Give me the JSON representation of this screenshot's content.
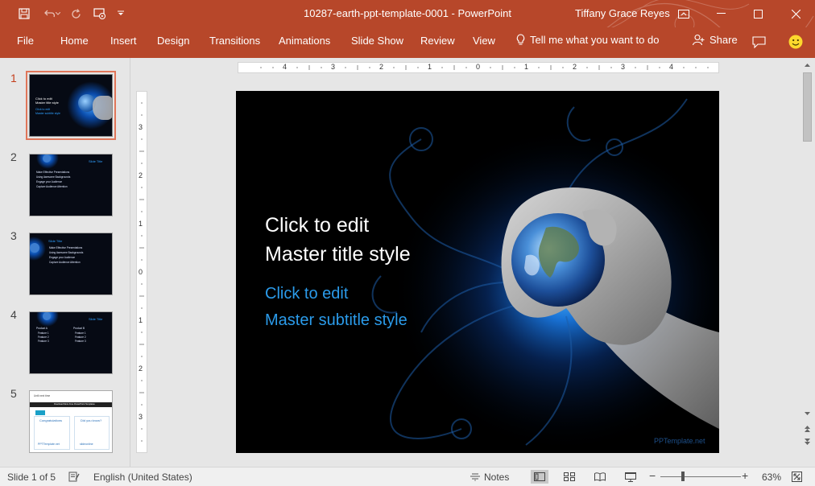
{
  "window": {
    "title": "10287-earth-ppt-template-0001  -  PowerPoint",
    "user": "Tiffany Grace Reyes"
  },
  "ribbon": {
    "tabs": [
      "File",
      "Home",
      "Insert",
      "Design",
      "Transitions",
      "Animations",
      "Slide Show",
      "Review",
      "View"
    ],
    "tell_me": "Tell me what you want to do",
    "share": "Share"
  },
  "thumbnails": {
    "numbers": [
      "1",
      "2",
      "3",
      "4",
      "5"
    ],
    "selected": 1,
    "slide1": {
      "title": "Click to edit\nMaster title style",
      "sub": "Click to edit\nMaster subtitle style"
    },
    "slide2": {
      "heading": "Slide Title",
      "bullets": [
        "Make Effective Presentations",
        "Using Awesome Backgrounds",
        "Engage your Audience",
        "Capture Audience Attention"
      ]
    },
    "slide3": {
      "heading": "Slide Title",
      "bullets": [
        "Make Effective Presentations",
        "Using Awesome Backgrounds",
        "Engage your Audience",
        "Capture Audience Attention"
      ]
    },
    "slide4": {
      "heading": "Slide Title",
      "col1_head": "Product A",
      "col2_head": "Product B",
      "features": [
        "Feature 1",
        "Feature 2",
        "Feature 3"
      ]
    },
    "slide5": {
      "top": "Until next time",
      "banner": "Download More Free PowerPoint Templates",
      "left_head": "Congratulations",
      "right_head": "Did you know?",
      "left_logo": "PPTTemplate.net",
      "right_logo": "slideonline"
    }
  },
  "rulers": {
    "horizontal": [
      "4",
      "3",
      "2",
      "1",
      "0",
      "1",
      "2",
      "3",
      "4"
    ],
    "vertical": [
      "3",
      "2",
      "1",
      "0",
      "1",
      "2",
      "3"
    ]
  },
  "slide": {
    "title_line1": "Click to edit",
    "title_line2": "Master title style",
    "subtitle_line1": "Click to edit",
    "subtitle_line2": "Master subtitle style",
    "logo_text": "PPTemplate.net"
  },
  "statusbar": {
    "slide_info": "Slide 1 of 5",
    "language": "English (United States)",
    "notes": "Notes",
    "zoom": "63%"
  },
  "colors": {
    "accent": "#b7472a",
    "subtitle": "#2b9bea",
    "selected_outline": "#e0765a"
  }
}
